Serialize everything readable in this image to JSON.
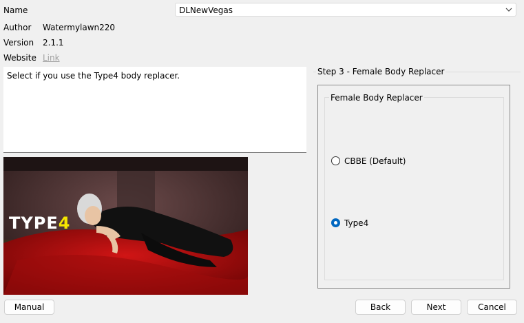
{
  "info": {
    "name_label": "Name",
    "name_value": "DLNewVegas",
    "author_label": "Author",
    "author_value": "Watermylawn220",
    "version_label": "Version",
    "version_value": "2.1.1",
    "website_label": "Website",
    "website_link": "Link"
  },
  "description": "Select if you use the Type4 body replacer.",
  "preview": {
    "overlay_text": "TYPE",
    "overlay_digit": "4"
  },
  "step": {
    "title": "Step 3 - Female Body Replacer",
    "group_title": "Female Body Replacer",
    "options": [
      {
        "label": "CBBE (Default)",
        "selected": false
      },
      {
        "label": "Type4",
        "selected": true
      }
    ]
  },
  "buttons": {
    "manual": "Manual",
    "back": "Back",
    "next": "Next",
    "cancel": "Cancel"
  },
  "colors": {
    "accent": "#0067c0",
    "overlay_digit": "#f5e600"
  }
}
